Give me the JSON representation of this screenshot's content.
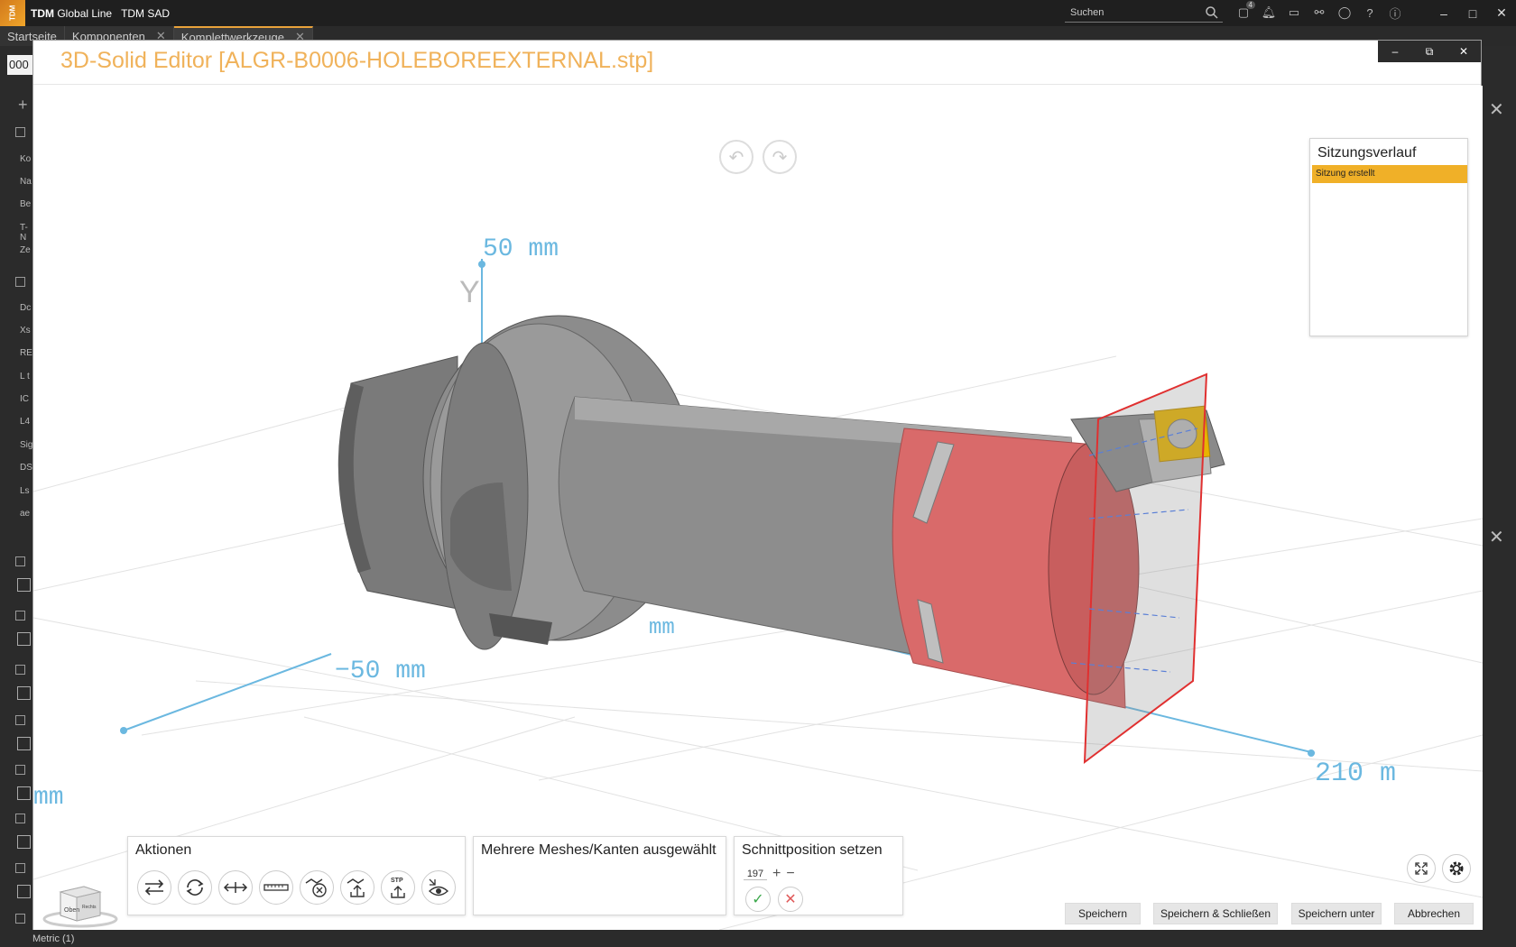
{
  "app": {
    "brand_bold": "TDM",
    "brand_rest": "Global Line",
    "module": "TDM SAD",
    "search_placeholder": "Suchen",
    "notification_count": "4"
  },
  "tabs": [
    {
      "label": "Startseite"
    },
    {
      "label": "Komponenten"
    },
    {
      "label": "Komplettwerkzeuge"
    }
  ],
  "left_panel": {
    "field_value": "000",
    "items": [
      "Ko",
      "Na",
      "Be",
      "T-N",
      "Ze",
      "Dc",
      "Xs",
      "RE",
      "L t",
      "IC",
      "L4",
      "Sig",
      "DS",
      "Ls",
      "ae"
    ],
    "bottom_label": "Metric (1)"
  },
  "editor": {
    "title": "3D-Solid Editor [ALGR-B0006-HOLEBOREEXTERNAL.stp]",
    "history": {
      "title": "Sitzungsverlauf",
      "entries": [
        "Sitzung erstellt"
      ]
    },
    "viewport": {
      "axis_y_label": "Y",
      "label_50mm": "50 mm",
      "label_mm": "mm",
      "label_minus50": "−50 mm",
      "label_210": "210 m",
      "label_left_mm": "mm",
      "cube_front": "Oben",
      "cube_right": "Rechts"
    },
    "actions": {
      "title": "Aktionen",
      "stp_label": "STP",
      "icons": [
        "swap-arrows-icon",
        "rotate-icon",
        "measure-distance-icon",
        "ruler-icon",
        "remove-part-icon",
        "export-icon",
        "export-stp-icon",
        "visibility-icon"
      ]
    },
    "selection": {
      "title": "Mehrere Meshes/Kanten ausgewählt"
    },
    "section": {
      "title": "Schnittposition setzen",
      "value": "197"
    },
    "footer": {
      "save": "Speichern",
      "save_close": "Speichern & Schließen",
      "save_as": "Speichern unter",
      "cancel": "Abbrechen"
    }
  },
  "colors": {
    "accent": "#f0b028",
    "title": "#f0b25a",
    "axis": "#6bb8e0",
    "tool_gray": "#8a8a8a",
    "section_red": "#d96a6a",
    "insert_yellow": "#e8b400"
  }
}
